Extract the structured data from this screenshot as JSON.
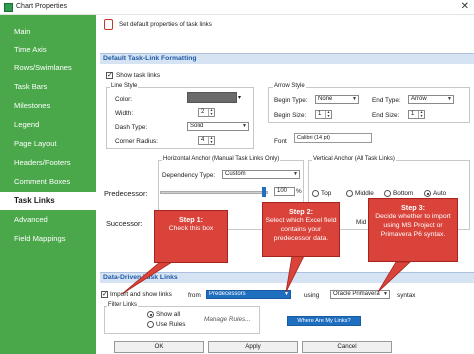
{
  "window": {
    "title": "Chart Properties",
    "close": "✕"
  },
  "sidebar": {
    "items": [
      {
        "label": "Main"
      },
      {
        "label": "Time Axis"
      },
      {
        "label": "Rows/Swimlanes"
      },
      {
        "label": "Task Bars"
      },
      {
        "label": "Milestones"
      },
      {
        "label": "Legend"
      },
      {
        "label": "Page Layout"
      },
      {
        "label": "Headers/Footers"
      },
      {
        "label": "Comment Boxes"
      },
      {
        "label": "Task Links"
      },
      {
        "label": "Advanced"
      },
      {
        "label": "Field Mappings"
      }
    ],
    "active_index": 9,
    "color": "#4aa84a"
  },
  "header": {
    "text": "Set default properties of task links"
  },
  "default_formatting": {
    "title": "Default Task-Link Formatting",
    "show_task_links": "Show task links",
    "line_style": {
      "title": "Line Style",
      "color_label": "Color:",
      "width_label": "Width:",
      "width_value": "2",
      "dash_type_label": "Dash Type:",
      "dash_type_value": "Solid",
      "corner_radius_label": "Corner Radius:",
      "corner_radius_value": "4"
    },
    "arrow_style": {
      "title": "Arrow Style",
      "begin_type_label": "Begin Type:",
      "begin_type_value": "None",
      "end_type_label": "End Type:",
      "end_type_value": "Arrow",
      "begin_size_label": "Begin Size:",
      "begin_size_value": "1",
      "end_size_label": "End Size:",
      "end_size_value": "1"
    },
    "font_label": "Font",
    "font_value": "Calibri (14 pt)",
    "horizontal_anchor": {
      "title": "Horizontal Anchor (Manual Task Links Only)",
      "dependency_type_label": "Dependency Type:",
      "dependency_type_value": "Custom",
      "percent_value": "100",
      "percent_unit": "%"
    },
    "vertical_anchor": {
      "title": "Vertical Anchor (All Task Links)",
      "options": [
        "Top",
        "Middle",
        "Bottom",
        "Auto"
      ],
      "selected": "Auto"
    },
    "predecessor_label": "Predecessor:",
    "successor_label": "Successor:",
    "successor_middle": "Mid"
  },
  "callouts": [
    {
      "step": "Step 1:",
      "text": "Check this box"
    },
    {
      "step": "Step 2:",
      "text": "Select which Excel field contains your predecessor data."
    },
    {
      "step": "Step 3:",
      "text": "Decide whether to import using MS Project or Primavera P6 syntax."
    }
  ],
  "data_driven": {
    "title": "Data-Driven Task Links",
    "import_label": "Import and show links",
    "from_label": "from",
    "field_value": "Predecessors",
    "using_label": "using",
    "syntax_value": "Oracle Primavera",
    "syntax_label": "syntax",
    "filter_links": {
      "title": "Filter Links",
      "options": [
        "Show all",
        "Use Rules"
      ],
      "selected": "Show all",
      "manage_rules": "Manage Rules..."
    },
    "help_button": "Where Are My Links?"
  },
  "footer": {
    "ok": "OK",
    "apply": "Apply",
    "cancel": "Cancel"
  },
  "colors": {
    "callout": "#d9433a",
    "section": "#1e5aa8",
    "line_color": "#6a6a6a",
    "accent_blue": "#1f6fc1"
  }
}
